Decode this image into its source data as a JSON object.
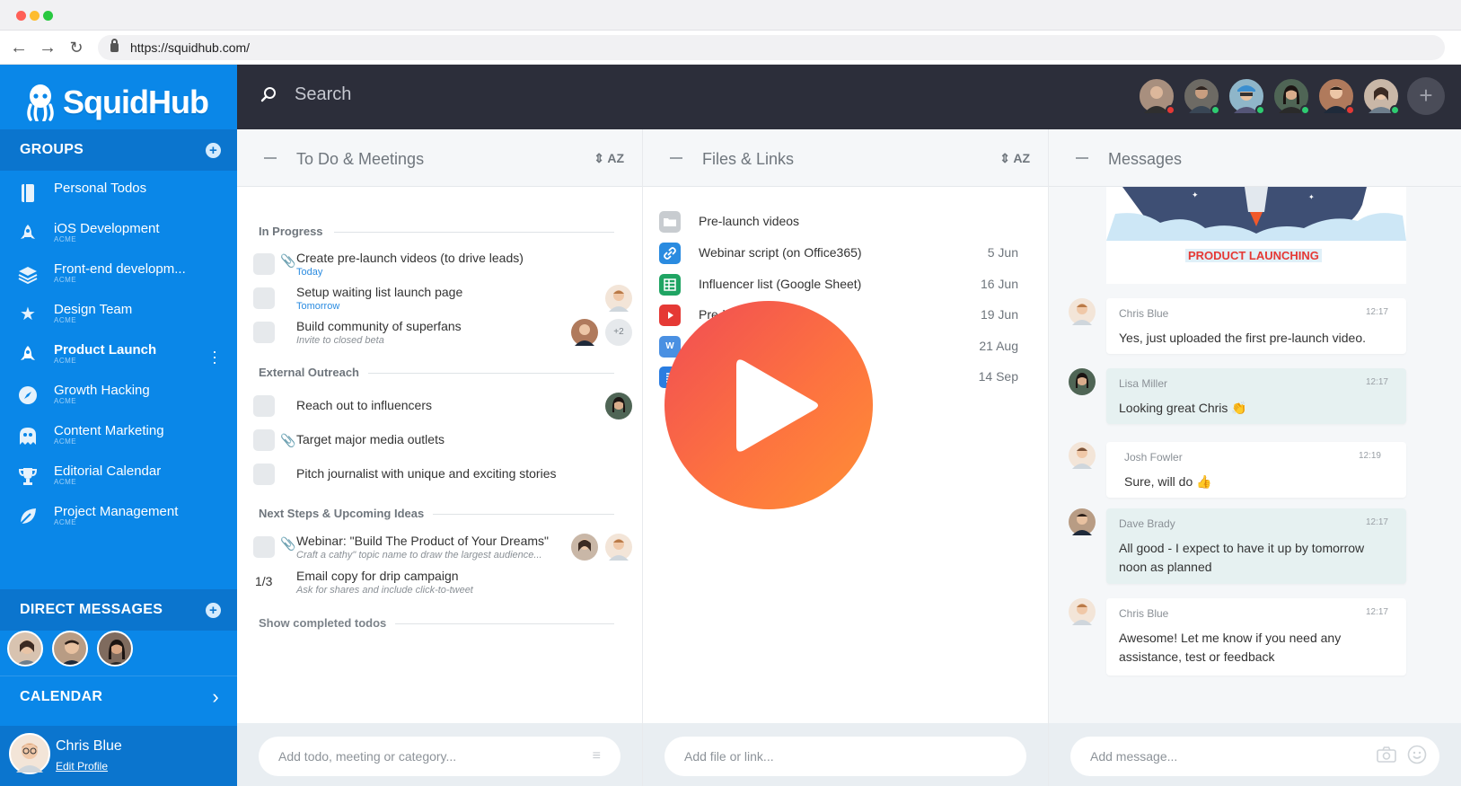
{
  "browser": {
    "url": "https://squidhub.com/"
  },
  "app": {
    "logo_text": "SquidHub"
  },
  "sidebar": {
    "groups_label": "GROUPS",
    "groups": [
      {
        "name": "Personal Todos",
        "sub": "",
        "icon": "book-icon"
      },
      {
        "name": "iOS Development",
        "sub": "ACME",
        "icon": "rocket-icon"
      },
      {
        "name": "Front-end developm...",
        "sub": "ACME",
        "icon": "layers-icon"
      },
      {
        "name": "Design Team",
        "sub": "ACME",
        "icon": "star-icon"
      },
      {
        "name": "Product Launch",
        "sub": "ACME",
        "icon": "rocket-icon",
        "active": true
      },
      {
        "name": "Growth Hacking",
        "sub": "ACME",
        "icon": "compass-icon"
      },
      {
        "name": "Content Marketing",
        "sub": "ACME",
        "icon": "ghost-icon"
      },
      {
        "name": "Editorial Calendar",
        "sub": "ACME",
        "icon": "trophy-icon"
      },
      {
        "name": "Project Management",
        "sub": "ACME",
        "icon": "leaf-icon"
      }
    ],
    "direct_messages_label": "DIRECT MESSAGES",
    "calendar_label": "CALENDAR",
    "profile": {
      "name": "Chris Blue",
      "edit": "Edit Profile"
    }
  },
  "topbar": {
    "search_placeholder": "Search"
  },
  "todo": {
    "title": "To Do & Meetings",
    "sort": "AZ",
    "categories": {
      "in_progress": "In Progress",
      "external": "External Outreach",
      "next": "Next Steps & Upcoming Ideas"
    },
    "items": [
      {
        "title": "Create pre-launch videos (to drive leads)",
        "sub": "Today"
      },
      {
        "title": "Setup waiting list launch page",
        "sub": "Tomorrow"
      },
      {
        "title": "Build community of superfans",
        "sub": "Invite to closed beta",
        "more": "+2"
      },
      {
        "title": "Reach out to influencers",
        "sub": ""
      },
      {
        "title": "Target major media outlets",
        "sub": ""
      },
      {
        "title": "Pitch journalist with unique and exciting stories",
        "sub": ""
      },
      {
        "title": "Webinar: \"Build The Product of Your Dreams\"",
        "sub": "Craft a cathy\" topic name to draw the largest audience..."
      },
      {
        "title": "Email copy for drip campaign",
        "sub": "Ask for shares and include click-to-tweet",
        "progress": "1/3"
      }
    ],
    "show_completed": "Show completed todos",
    "input_placeholder": "Add todo, meeting or category..."
  },
  "files": {
    "title": "Files & Links",
    "sort": "AZ",
    "items": [
      {
        "name": "Pre-launch videos",
        "date": "",
        "icon": "folder-icon",
        "color": "#b9bdc2"
      },
      {
        "name": "Webinar script (on Office365)",
        "date": "5 Jun",
        "icon": "link-icon",
        "color": "#2a8be0"
      },
      {
        "name": "Influencer list (Google Sheet)",
        "date": "16 Jun",
        "icon": "sheet-icon",
        "color": "#1fa463"
      },
      {
        "name": "Pre-la...mp4",
        "date": "19 Jun",
        "icon": "video-icon",
        "color": "#e53935"
      },
      {
        "name": "",
        "date": "21 Aug",
        "icon": "word-icon",
        "color": "#4a90e2"
      },
      {
        "name": "",
        "date": "14 Sep",
        "icon": "doc-icon",
        "color": "#2a7de1"
      }
    ],
    "input_placeholder": "Add file or link..."
  },
  "messages": {
    "title": "Messages",
    "launch_banner": "PRODUCT LAUNCHING",
    "items": [
      {
        "name": "Chris Blue",
        "time": "12:17",
        "text": "Yes, just uploaded the first pre-launch video."
      },
      {
        "name": "Lisa Miller",
        "time": "12:17",
        "text": "Looking great Chris 👏"
      },
      {
        "name": "Josh Fowler",
        "time": "12:19",
        "text": "Sure, will do 👍"
      },
      {
        "name": "Dave Brady",
        "time": "12:17",
        "text": "All good - I expect to have it up by tomorrow noon as planned"
      },
      {
        "name": "Chris Blue",
        "time": "12:17",
        "text": "Awesome! Let me know if you need any assistance, test or feedback"
      }
    ],
    "input_placeholder": "Add message..."
  },
  "colors": {
    "sidebar": "#0a87e8",
    "topbar": "#2c2e3a",
    "accent": "#fd7240"
  }
}
